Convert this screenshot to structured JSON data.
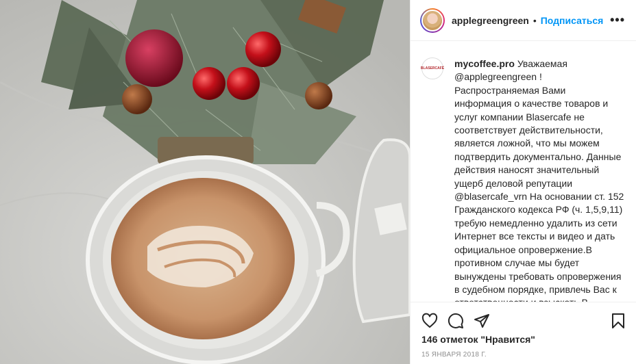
{
  "header": {
    "username": "applegreengreen",
    "separator": "•",
    "follow_label": "Подписаться",
    "more_label": "•••"
  },
  "comment": {
    "avatar_text": "BLASERCAFÉ",
    "username": "mycoffee.pro",
    "text": "Уважаемая @applegreengreen ! Распространяемая Вами информация о качестве товаров и услуг компании Blasercafe не соответствует действительности, является ложной, что мы можем подтвердить документально. Данные действия наносят значительный ущерб деловой репутации @blasercafe_vrn На основании ст. 152 Гражданского кодекса РФ (ч. 1,5,9,11) требую немедленно удалить из сети Интернет все тексты и видео и дать официальное опровержение.В противном случае мы будет вынуждены требовать опровержения в судебном порядке, привлечь Вас к ответственности и взыскать В..."
  },
  "actions": {
    "like_icon": "heart-icon",
    "comment_icon": "comment-icon",
    "share_icon": "share-icon",
    "save_icon": "bookmark-icon"
  },
  "likes": "146 отметок \"Нравится\"",
  "date": "15 ЯНВАРЯ 2018 Г.",
  "colors": {
    "follow": "#0095f6",
    "text": "#262626",
    "muted": "#8e8e8e"
  }
}
